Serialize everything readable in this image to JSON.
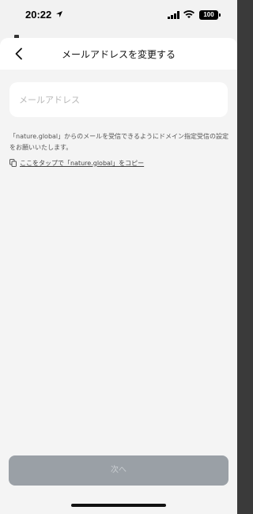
{
  "status_bar": {
    "time": "20:22",
    "battery": "100"
  },
  "nav": {
    "title": "メールアドレスを変更する"
  },
  "form": {
    "email_placeholder": "メールアドレス",
    "email_value": ""
  },
  "info": {
    "text": "「nature.global」からのメールを受信できるようにドメイン指定受信の設定をお願いいたします。",
    "copy_link_label": "ここをタップで「nature.global」をコピー"
  },
  "footer": {
    "next_label": "次へ",
    "next_enabled": false
  }
}
